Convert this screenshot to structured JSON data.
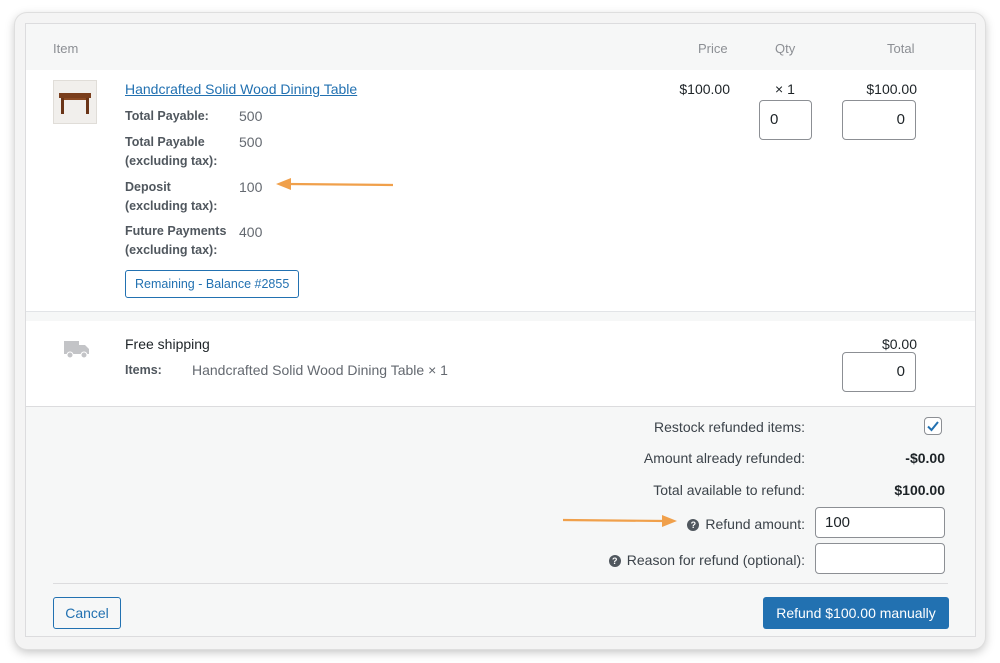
{
  "header": {
    "item": "Item",
    "price": "Price",
    "qty": "Qty",
    "total": "Total"
  },
  "line_item": {
    "name": "Handcrafted Solid Wood Dining Table",
    "meta": [
      {
        "key": "Total Payable:",
        "value": "500"
      },
      {
        "key": "Total Payable (excluding tax):",
        "value": "500"
      },
      {
        "key": "Deposit (excluding tax):",
        "value": "100"
      },
      {
        "key": "Future Payments (excluding tax):",
        "value": "400"
      }
    ],
    "tag": "Remaining - Balance #2855",
    "price": "$100.00",
    "qty": "× 1",
    "total": "$100.00",
    "refund_qty": "0",
    "refund_total": "0"
  },
  "shipping": {
    "title": "Free shipping",
    "items_label": "Items:",
    "items_value": "Handcrafted Solid Wood Dining Table × 1",
    "total": "$0.00",
    "refund_total": "0"
  },
  "totals": {
    "restock_label": "Restock refunded items:",
    "restock_checked": true,
    "already_refunded_label": "Amount already refunded:",
    "already_refunded_value": "-$0.00",
    "available_label": "Total available to refund:",
    "available_value": "$100.00",
    "refund_amount_label": "Refund amount:",
    "refund_amount_value": "100",
    "reason_label": "Reason for refund (optional):",
    "reason_value": ""
  },
  "buttons": {
    "cancel": "Cancel",
    "refund": "Refund $100.00 manually"
  },
  "colors": {
    "accent": "#2271b1",
    "annotation_arrow": "#f0a04b"
  }
}
